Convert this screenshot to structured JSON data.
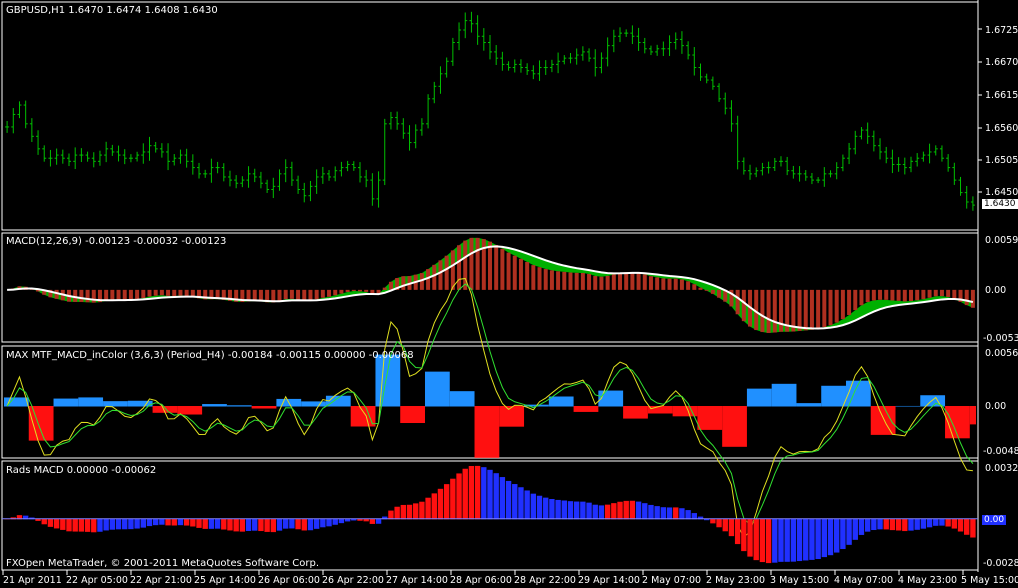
{
  "main": {
    "header": "GBPUSD,H1  1.6470 1.6474 1.6408 1.6430",
    "price_axis": [
      "1.6725",
      "1.6670",
      "1.6615",
      "1.6560",
      "1.6505",
      "1.6450"
    ],
    "current_price": "1.6430",
    "candle_color": "#00c000",
    "closes": [
      1.6555,
      1.6575,
      1.659,
      1.656,
      1.654,
      1.652,
      1.6505,
      1.6505,
      1.651,
      1.6505,
      1.65,
      1.651,
      1.651,
      1.6505,
      1.65,
      1.651,
      1.652,
      1.6515,
      1.651,
      1.6505,
      1.6505,
      1.651,
      1.6515,
      1.6525,
      1.652,
      1.6515,
      1.65,
      1.6505,
      1.651,
      1.65,
      1.649,
      1.648,
      1.648,
      1.649,
      1.649,
      1.6475,
      1.647,
      1.6465,
      1.647,
      1.648,
      1.6475,
      1.6465,
      1.6455,
      1.646,
      1.648,
      1.649,
      1.647,
      1.6455,
      1.6445,
      1.646,
      1.6475,
      1.648,
      1.6475,
      1.6485,
      1.649,
      1.6495,
      1.649,
      1.6475,
      1.647,
      1.644,
      1.647,
      1.656,
      1.657,
      1.656,
      1.6545,
      1.653,
      1.655,
      1.656,
      1.66,
      1.662,
      1.664,
      1.666,
      1.669,
      1.671,
      1.6725,
      1.672,
      1.67,
      1.669,
      1.6675,
      1.6665,
      1.6655,
      1.665,
      1.6655,
      1.665,
      1.6645,
      1.664,
      1.665,
      1.665,
      1.6655,
      1.666,
      1.6665,
      1.6665,
      1.667,
      1.6675,
      1.6665,
      1.665,
      1.6665,
      1.6685,
      1.67,
      1.6705,
      1.6705,
      1.67,
      1.669,
      1.668,
      1.6675,
      1.668,
      1.668,
      1.669,
      1.6695,
      1.6685,
      1.667,
      1.665,
      1.6635,
      1.663,
      1.662,
      1.66,
      1.6585,
      1.656,
      1.65,
      1.6485,
      1.648,
      1.6485,
      1.649,
      1.649,
      1.65,
      1.65,
      1.6485,
      1.648,
      1.648,
      1.6475,
      1.647,
      1.647,
      1.648,
      1.648,
      1.649,
      1.6505,
      1.652,
      1.654,
      1.655,
      1.654,
      1.6525,
      1.6515,
      1.6505,
      1.6495,
      1.6495,
      1.649,
      1.65,
      1.6505,
      1.651,
      1.6515,
      1.652,
      1.6505,
      1.649,
      1.647,
      1.645,
      1.6435,
      1.643
    ]
  },
  "macd": {
    "header": "MACD(12,26,9) -0.00123 -0.00032 -0.00123",
    "axis": [
      "0.00592",
      "0.00",
      "-0.00539"
    ],
    "hist_color": "#b03020",
    "signal_fill_color": "#00b000",
    "signal_line_color": "#ffffff",
    "scale_max": 0.00592,
    "scale_min": -0.00539
  },
  "mtf": {
    "header": "MAX MTF_MACD_inColor (3,6,3) (Period_H4) -0.00184 -0.00115 0.00000 -0.00068",
    "axis": [
      "0.00566",
      "0.00",
      "-0.00485"
    ],
    "pos_color": "#2090ff",
    "neg_color": "#ff1010",
    "line1_color": "#e0e020",
    "line2_color": "#30e030",
    "scale_max": 0.00566,
    "scale_min": -0.00485
  },
  "rads": {
    "header": "Rads MACD 0.00000 -0.00062",
    "axis": [
      "0.00326",
      "-0.00286"
    ],
    "zero_box": "0.00",
    "pos_color": "#2030ff",
    "neg_color": "#ff1010",
    "zero_line_color": "#8080ff",
    "scale_max": 0.00326,
    "scale_min": -0.00286
  },
  "time_axis": [
    "21 Apr 2011",
    "22 Apr 05:00",
    "22 Apr 21:00",
    "25 Apr 14:00",
    "26 Apr 06:00",
    "26 Apr 22:00",
    "27 Apr 14:00",
    "28 Apr 06:00",
    "28 Apr 22:00",
    "29 Apr 14:00",
    "2 May 07:00",
    "2 May 23:00",
    "3 May 15:00",
    "4 May 07:00",
    "4 May 23:00",
    "5 May 15:00"
  ],
  "copyright": "FXOpen MetaTrader, © 2001-2011 MetaQuotes Software Corp."
}
